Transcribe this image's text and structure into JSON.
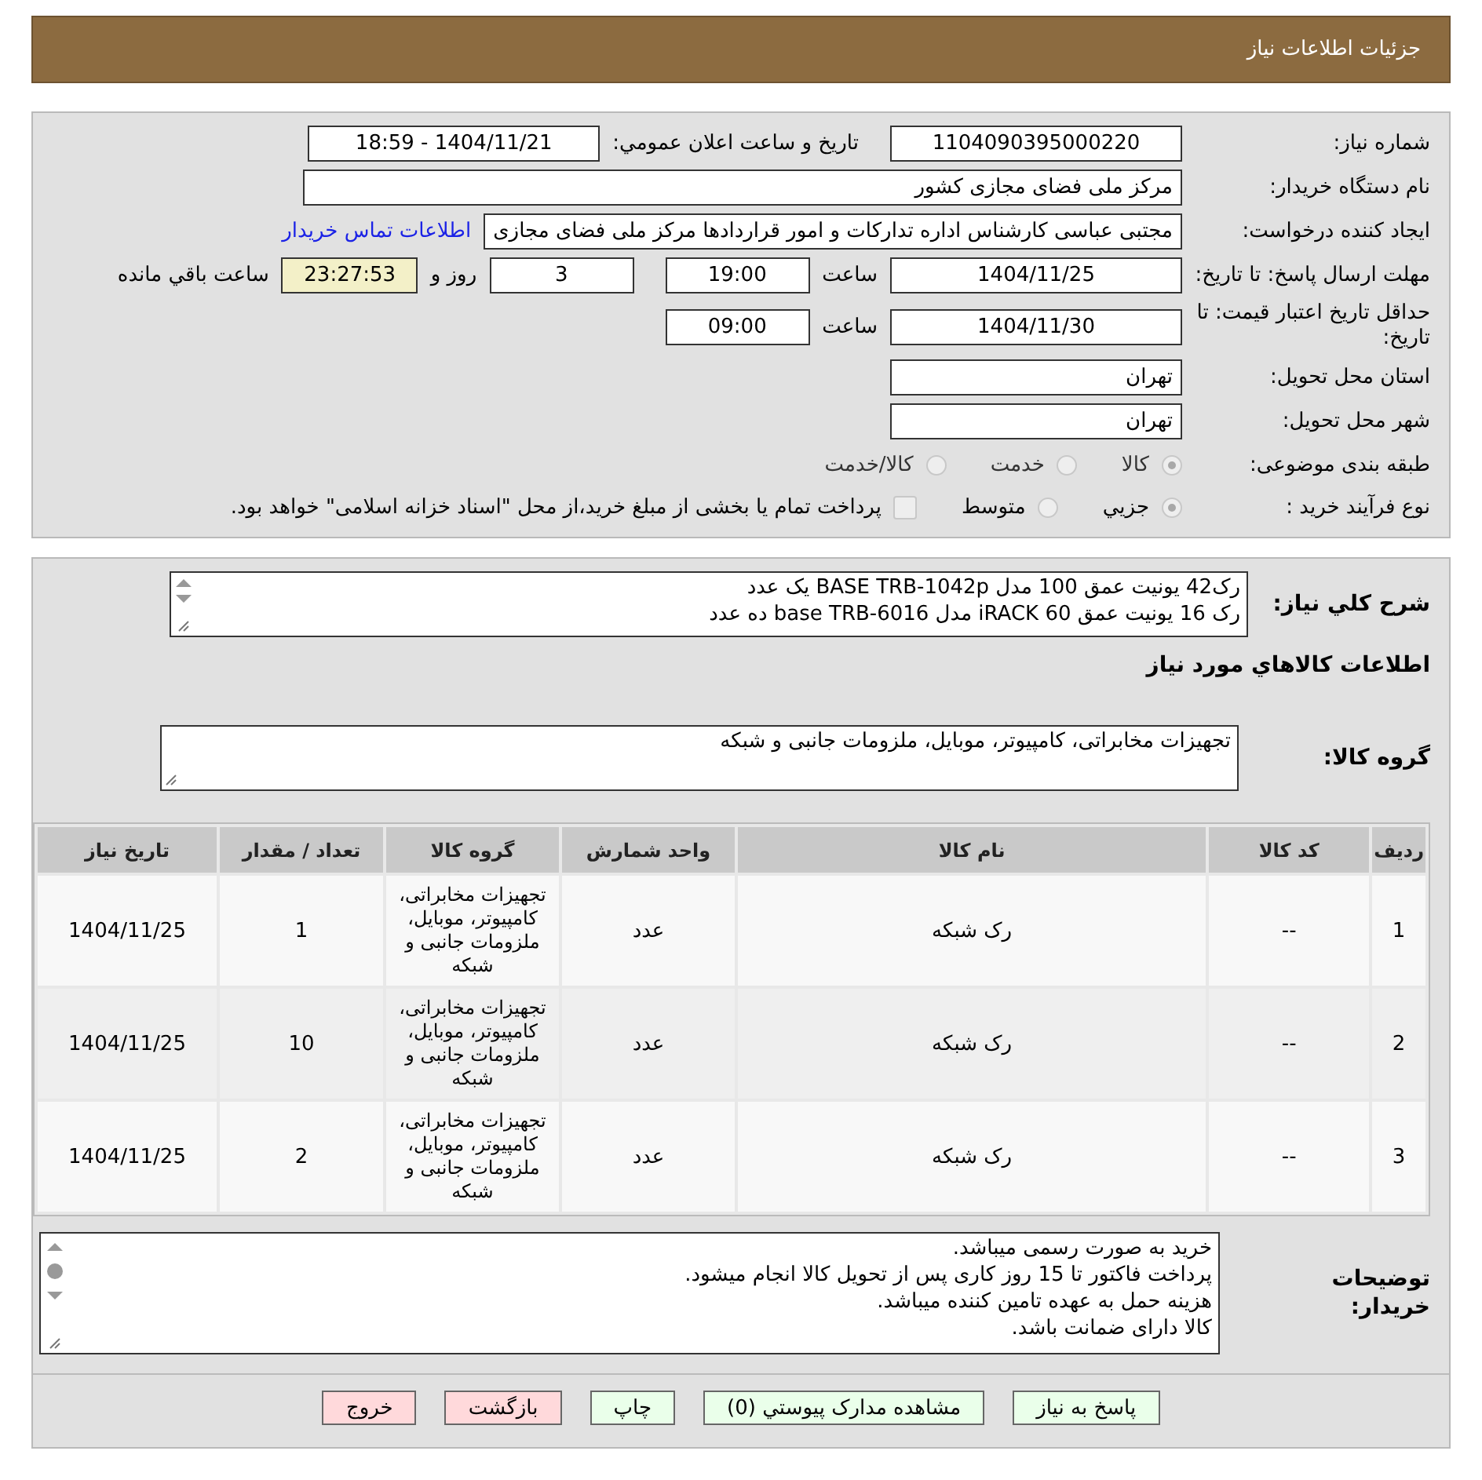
{
  "header": {
    "title": "جزئیات اطلاعات نیاز"
  },
  "need_number": {
    "label": "شماره نیاز:",
    "value": "1104090395000220"
  },
  "announce": {
    "label": "تاریخ و ساعت اعلان عمومي:",
    "value": "1404/11/21 - 18:59"
  },
  "buyer": {
    "label": "نام دستگاه خریدار:",
    "value": "مرکز ملی فضای مجازی کشور"
  },
  "creator": {
    "label": "ایجاد کننده درخواست:",
    "value": "مجتبی عباسی کارشناس اداره تدارکات و امور قراردادها مرکز ملی فضای مجازی",
    "link": "اطلاعات تماس خریدار"
  },
  "deadline": {
    "label": "مهلت ارسال پاسخ: تا تاریخ:",
    "date": "1404/11/25",
    "time_label": "ساعت",
    "time": "19:00",
    "days": "3",
    "days_label": "روز و",
    "remaining": "23:27:53",
    "remaining_label": "ساعت باقي مانده"
  },
  "validity": {
    "label": "حداقل تاریخ اعتبار قیمت: تا تاریخ:",
    "date": "1404/11/30",
    "time_label": "ساعت",
    "time": "09:00"
  },
  "province": {
    "label": "استان محل تحویل:",
    "value": "تهران"
  },
  "city": {
    "label": "شهر محل تحویل:",
    "value": "تهران"
  },
  "category": {
    "label": "طبقه بندی موضوعی:",
    "options": [
      {
        "label": "کالا",
        "selected": true
      },
      {
        "label": "خدمت",
        "selected": false
      },
      {
        "label": "کالا/خدمت",
        "selected": false
      }
    ]
  },
  "process": {
    "label": "نوع فرآیند خرید :",
    "options": [
      {
        "label": "جزيي",
        "selected": true
      },
      {
        "label": "متوسط",
        "selected": false
      }
    ],
    "payment": {
      "label": "پرداخت تمام یا بخشی از مبلغ خرید،از محل \"اسناد خزانه اسلامی\" خواهد بود.",
      "checked": false
    }
  },
  "summary": {
    "label": "شرح کلي نياز:",
    "lines": [
      "رک42 یونیت عمق 100 مدل BASE TRB-1042p یک عدد",
      "رک 16 یونیت عمق 60 iRACK مدل base TRB-6016 ده عدد"
    ]
  },
  "goods_heading": "اطلاعات کالاهاي مورد نياز",
  "goods_group": {
    "label": "گروه کالا:",
    "value": "تجهیزات مخابراتی، کامپیوتر، موبایل، ملزومات جانبی و شبکه"
  },
  "table": {
    "columns": [
      "ردیف",
      "کد کالا",
      "نام کالا",
      "واحد شمارش",
      "گروه کالا",
      "تعداد / مقدار",
      "تاریخ نیاز"
    ],
    "rows": [
      [
        "1",
        "--",
        "رک شبکه",
        "عدد",
        "تجهیزات مخابراتی، کامپیوتر، موبایل، ملزومات جانبی و شبکه",
        "1",
        "1404/11/25"
      ],
      [
        "2",
        "--",
        "رک شبکه",
        "عدد",
        "تجهیزات مخابراتی، کامپیوتر، موبایل، ملزومات جانبی و شبکه",
        "10",
        "1404/11/25"
      ],
      [
        "3",
        "--",
        "رک شبکه",
        "عدد",
        "تجهیزات مخابراتی، کامپیوتر، موبایل، ملزومات جانبی و شبکه",
        "2",
        "1404/11/25"
      ]
    ]
  },
  "notes": {
    "label": "توضیحات خریدار:",
    "lines": [
      "خرید به صورت رسمی میباشد.",
      "پرداخت فاکتور تا 15 روز کاری پس از تحویل کالا انجام میشود.",
      "هزینه حمل به عهده تامین کننده میباشد.",
      "کالا دارای ضمانت باشد."
    ]
  },
  "buttons": [
    {
      "label": "پاسخ به نیاز",
      "kind": "action"
    },
    {
      "label": "مشاهده مدارک پیوستي (0)",
      "kind": "action"
    },
    {
      "label": "چاپ",
      "kind": "action"
    },
    {
      "label": "بازگشت",
      "kind": "exit"
    },
    {
      "label": "خروج",
      "kind": "exit"
    }
  ]
}
